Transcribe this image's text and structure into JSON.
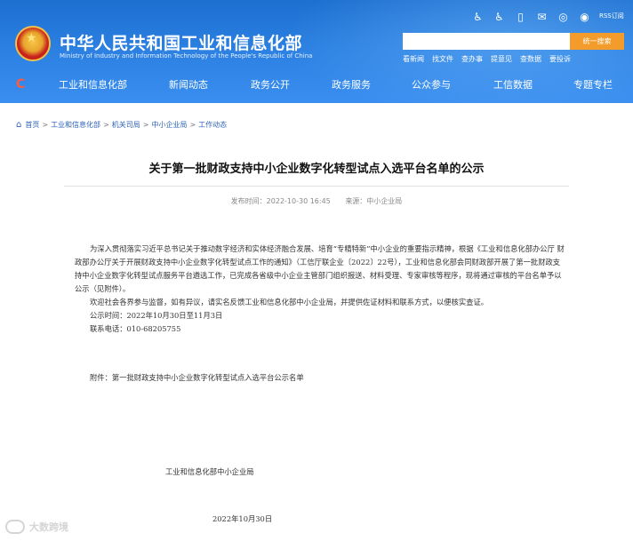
{
  "header": {
    "site_title": "中华人民共和国工业和信息化部",
    "site_subtitle": "Ministry of Industry and Information Technology of the People's Republic of China",
    "tool_icons": [
      "accessibility-icon",
      "wheelchair-icon",
      "mobile-icon",
      "mail-icon",
      "wechat-icon",
      "weibo-icon"
    ],
    "rss_label": "RSS订阅",
    "search_placeholder": "",
    "search_button": "统一搜索",
    "quick_links": [
      "看新闻",
      "找文件",
      "查办事",
      "提意见",
      "查数据",
      "要投诉"
    ]
  },
  "nav": {
    "items": [
      "工业和信息化部",
      "新闻动态",
      "政务公开",
      "政务服务",
      "公众参与",
      "工信数据",
      "专题专栏"
    ]
  },
  "breadcrumb": {
    "items": [
      "首页",
      "工业和信息化部",
      "机关司局",
      "中小企业局",
      "工作动态"
    ],
    "separator": ">"
  },
  "article": {
    "title": "关于第一批财政支持中小企业数字化转型试点入选平台名单的公示",
    "publish_time": "发布时间：2022-10-30 16:45",
    "source": "来源：中小企业局",
    "paragraph1": "为深入贯彻落实习近平总书记关于推动数字经济和实体经济融合发展、培育“专精特新”中小企业的重要指示精神，根据《工业和信息化部办公厅 财政部办公厅关于开展财政支持中小企业数字化转型试点工作的通知》（工信厅联企业〔2022〕22号），工业和信息化部会同财政部开展了第一批财政支持中小企业数字化转型试点服务平台遴选工作，已完成各省级中小企业主管部门组织报送、材料受理、专家审核等程序，现将通过审核的平台名单予以公示（见附件）。",
    "paragraph2": "欢迎社会各界参与监督，如有异议，请实名反馈工业和信息化部中小企业局，并提供佐证材料和联系方式，以便核实查证。",
    "line_time": "公示时间：2022年10月30日至11月3日",
    "line_phone": "联系电话：010-68205755",
    "attachment": "附件：第一批财政支持中小企业数字化转型试点入选平台公示名单",
    "signature_org": "工业和信息化部中小企业局",
    "signature_date": "2022年10月30日"
  },
  "watermark": "大数跨境",
  "colors": {
    "header_blue": "#2a7fe0",
    "search_button": "#f39c2b",
    "link_blue": "#2e63b8"
  }
}
